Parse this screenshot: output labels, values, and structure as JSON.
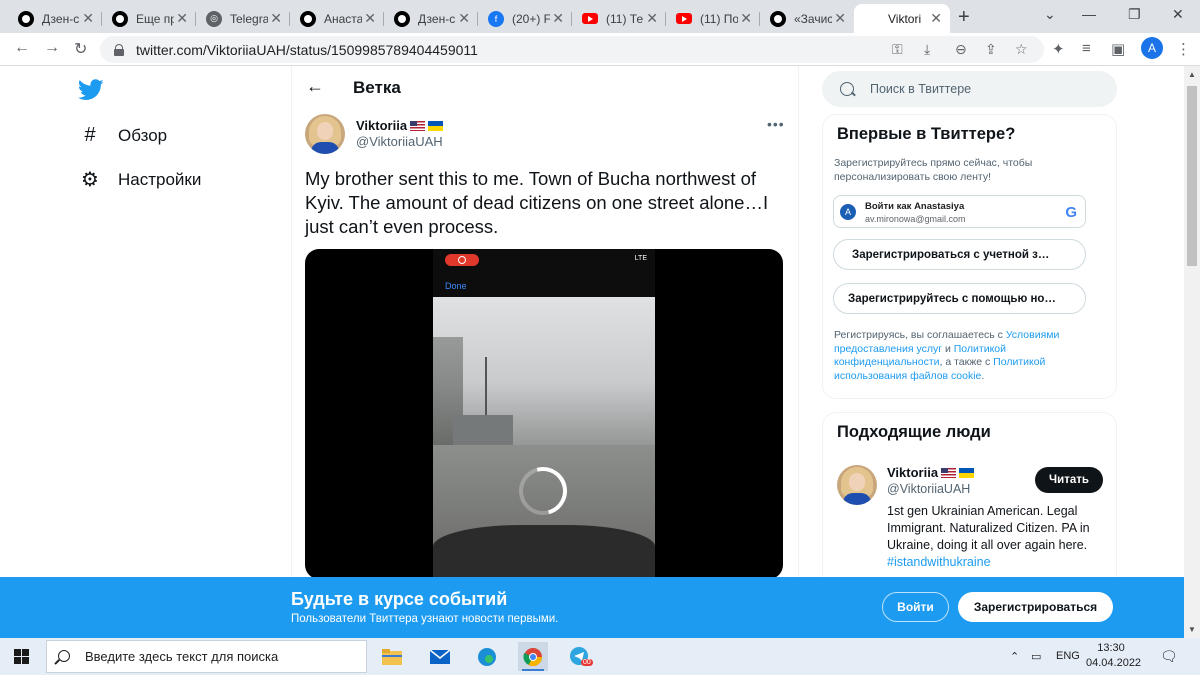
{
  "browser": {
    "tabs": [
      {
        "label": "Дзен-с",
        "icon": "dzen-icon"
      },
      {
        "label": "Еще пр",
        "icon": "dzen-icon"
      },
      {
        "label": "Telegra",
        "icon": "globe-icon"
      },
      {
        "label": "Анаста",
        "icon": "dzen-icon"
      },
      {
        "label": "Дзен-с",
        "icon": "dzen-icon"
      },
      {
        "label": "(20+) F",
        "icon": "facebook-icon"
      },
      {
        "label": "(11) Те",
        "icon": "youtube-icon"
      },
      {
        "label": "(11) По",
        "icon": "youtube-icon"
      },
      {
        "label": "«Зачис",
        "icon": "dzen-icon"
      },
      {
        "label": "Viktori",
        "icon": "twitter-icon",
        "active": true
      }
    ],
    "url": "twitter.com/ViktoriiaUAH/status/1509985789404459011",
    "profile_initial": "A"
  },
  "nav": {
    "items": [
      {
        "label": "Обзор",
        "icon": "hashtag-icon"
      },
      {
        "label": "Настройки",
        "icon": "gear-icon"
      }
    ]
  },
  "thread": {
    "title": "Ветка",
    "author": {
      "name": "Viktoriia",
      "handle": "@ViktoriiaUAH"
    },
    "text": "My brother sent this to me. Town of Bucha northwest of Kyiv. The amount of dead citizens on one street alone…I just can’t even process.",
    "video": {
      "done_label": "Done",
      "status": "LTE"
    }
  },
  "sidebar": {
    "search_placeholder": "Поиск в Твиттере",
    "signup_card": {
      "title": "Впервые в Твиттере?",
      "subtitle": "Зарегистрируйтесь прямо сейчас, чтобы персонализировать свою ленту!",
      "google": {
        "initial": "A",
        "label": "Войти как Anastasiya",
        "email": "av.mironowa@gmail.com",
        "logo": "G"
      },
      "apple_label": "Зарегистрироваться с учетной з…",
      "phone_label": "Зарегистрируйтесь с помощью но…",
      "legal_prefix": "Регистрируясь, вы соглашаетесь с ",
      "legal_terms": "Условиями предоставления услуг",
      "legal_and": " и ",
      "legal_privacy": "Политикой конфиденциальности",
      "legal_also": ", а также с ",
      "legal_cookie": "Политикой использования файлов cookie",
      "legal_end": "."
    },
    "people_card": {
      "title": "Подходящие люди",
      "person": {
        "name": "Viktoriia",
        "handle": "@ViktoriiaUAH",
        "follow_label": "Читать",
        "bio": "1st gen Ukrainian American. Legal Immigrant. Naturalized Citizen. PA in Ukraine, doing it all over again here.",
        "hashtag": "#istandwithukraine"
      }
    }
  },
  "banner": {
    "title": "Будьте в курсе событий",
    "subtitle": "Пользователи Твиттера узнают новости первыми.",
    "login_label": "Войти",
    "signup_label": "Зарегистрироваться"
  },
  "taskbar": {
    "search_placeholder": "Введите здесь текст для поиска",
    "language": "ENG",
    "time": "13:30",
    "date": "04.04.2022",
    "telegram_badge": "00"
  },
  "colors": {
    "twitter_blue": "#1d9bf0",
    "text": "#0f1419",
    "muted": "#536471"
  }
}
